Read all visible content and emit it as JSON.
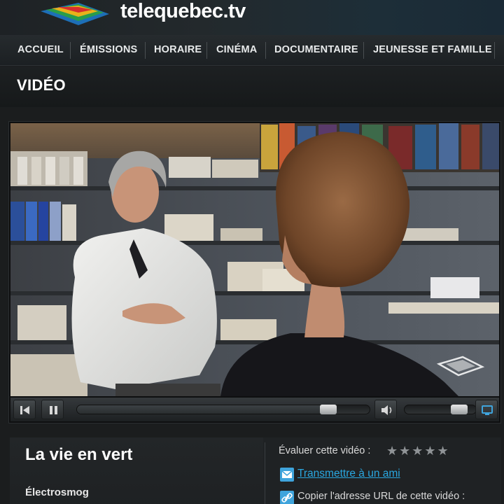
{
  "site": {
    "logo_text": "telequebec.tv"
  },
  "nav": {
    "items": [
      {
        "label": "ACCUEIL"
      },
      {
        "label": "ÉMISSIONS"
      },
      {
        "label": "HORAIRE"
      },
      {
        "label": "CINÉMA"
      },
      {
        "label": "DOCUMENTAIRE"
      },
      {
        "label": "JEUNESSE ET FAMILLE"
      }
    ]
  },
  "section": {
    "title": "VIDÉO"
  },
  "player": {
    "progress_fraction": 0.88,
    "volume_fraction": 0.85,
    "icons": {
      "rewind": "skip-back-icon",
      "pause": "pause-icon",
      "volume": "speaker-icon",
      "fullscreen": "screen-icon",
      "watermark": "channel-watermark-icon"
    }
  },
  "video_info": {
    "title": "La vie en vert",
    "episode": "Électrosmog",
    "rate_label": "Évaluer cette vidéo :",
    "stars": "★★★★★",
    "star_count": 5,
    "share_label": "Transmettre à un ami",
    "copy_url_label": "Copier l'adresse URL de cette vidéo :"
  },
  "colors": {
    "link": "#2aa7e0",
    "background": "#1b1d1e"
  }
}
